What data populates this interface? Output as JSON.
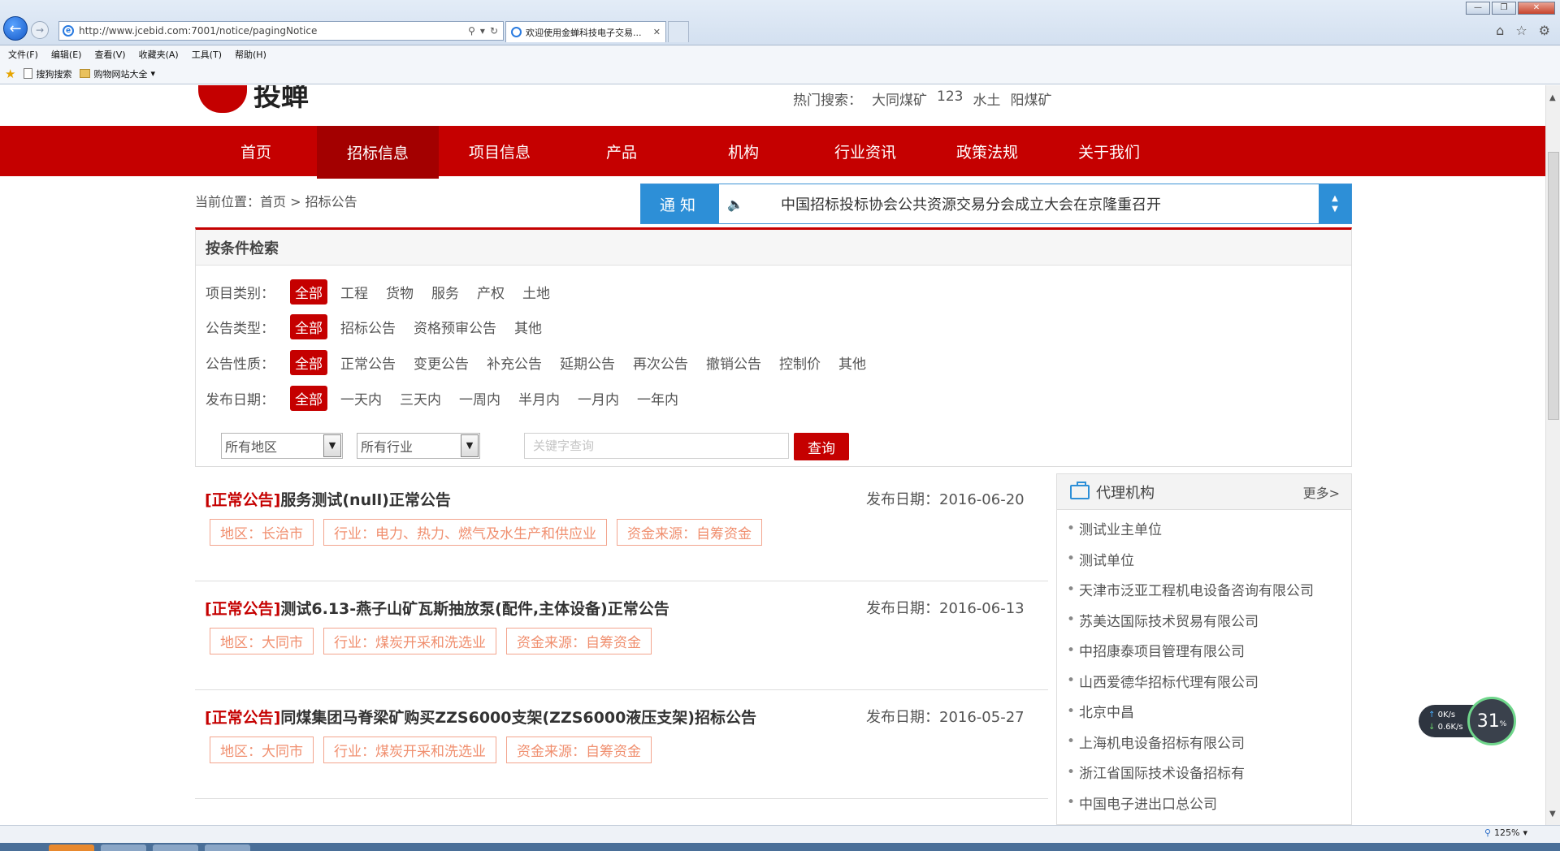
{
  "browser": {
    "url": "http://www.jcebid.com:7001/notice/pagingNotice",
    "tab_title": "欢迎使用金蝉科技电子交易...",
    "menu": [
      "文件(F)",
      "编辑(E)",
      "查看(V)",
      "收藏夹(A)",
      "工具(T)",
      "帮助(H)"
    ],
    "favorites": [
      "搜狗搜索",
      "购物网站大全"
    ],
    "zoom": "125%"
  },
  "header": {
    "logo_text": "投蝉",
    "hot_search_label": "热门搜索：",
    "hot_search_items": [
      "大同煤矿",
      "123",
      "水土",
      "阳煤矿"
    ]
  },
  "nav": {
    "items": [
      "首页",
      "招标信息",
      "项目信息",
      "产品",
      "机构",
      "行业资讯",
      "政策法规",
      "关于我们"
    ],
    "active": "招标信息"
  },
  "breadcrumb": "当前位置：首页 > 招标公告",
  "notice_bar": {
    "label": "通知",
    "text": "中国招标投标协会公共资源交易分会成立大会在京隆重召开"
  },
  "filter": {
    "title": "按条件检索",
    "rows": [
      {
        "label": "项目类别：",
        "options": [
          "全部",
          "工程",
          "货物",
          "服务",
          "产权",
          "土地"
        ]
      },
      {
        "label": "公告类型：",
        "options": [
          "全部",
          "招标公告",
          "资格预审公告",
          "其他"
        ]
      },
      {
        "label": "公告性质：",
        "options": [
          "全部",
          "正常公告",
          "变更公告",
          "补充公告",
          "延期公告",
          "再次公告",
          "撤销公告",
          "控制价",
          "其他"
        ]
      },
      {
        "label": "发布日期：",
        "options": [
          "全部",
          "一天内",
          "三天内",
          "一周内",
          "半月内",
          "一月内",
          "一年内"
        ]
      }
    ],
    "region_select": "所有地区",
    "industry_select": "所有行业",
    "keyword_placeholder": "关键字查询",
    "query_button": "查询"
  },
  "notices": [
    {
      "tag": "[正常公告]",
      "title": "服务测试(null)正常公告",
      "date": "发布日期：2016-06-20",
      "region": "地区：长治市",
      "industry": "行业：电力、热力、燃气及水生产和供应业",
      "fund": "资金来源：自筹资金"
    },
    {
      "tag": "[正常公告]",
      "title": "测试6.13-燕子山矿瓦斯抽放泵(配件,主体设备)正常公告",
      "date": "发布日期：2016-06-13",
      "region": "地区：大同市",
      "industry": "行业：煤炭开采和洗选业",
      "fund": "资金来源：自筹资金"
    },
    {
      "tag": "[正常公告]",
      "title": "同煤集团马脊梁矿购买ZZS6000支架(ZZS6000液压支架)招标公告",
      "date": "发布日期：2016-05-27",
      "region": "地区：大同市",
      "industry": "行业：煤炭开采和洗选业",
      "fund": "资金来源：自筹资金"
    }
  ],
  "agencies": {
    "title": "代理机构",
    "more": "更多>",
    "items": [
      "测试业主单位",
      "测试单位",
      "天津市泛亚工程机电设备咨询有限公司",
      "苏美达国际技术贸易有限公司",
      "中招康泰项目管理有限公司",
      "山西爱德华招标代理有限公司",
      "北京中昌",
      "上海机电设备招标有限公司",
      "浙江省国际技术设备招标有",
      "中国电子进出口总公司"
    ]
  },
  "net_widget": {
    "up": "0K/s",
    "down": "0.6K/s",
    "percent": "31",
    "unit": "%"
  }
}
